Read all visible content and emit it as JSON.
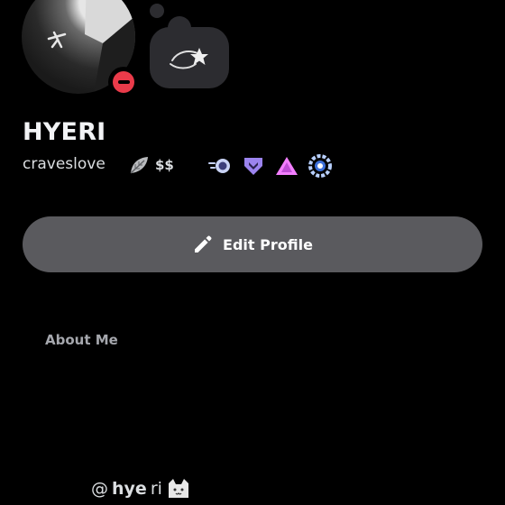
{
  "profile": {
    "display_name": "HYERI",
    "username": "craveslove",
    "dollars": "$$",
    "status": "dnd"
  },
  "actions": {
    "edit_profile_label": "Edit Profile"
  },
  "about": {
    "title": "About Me",
    "at_symbol": "@",
    "handle_bold": "hye",
    "handle_rest": "ri"
  },
  "icons": {
    "leaf": "leaf-icon",
    "badges": [
      "nitro-orb-badge",
      "hypesquad-bravery-badge",
      "triangle-badge",
      "laurel-badge"
    ],
    "status_bubble": "shooting-star-icon",
    "cat": "cat-icon"
  },
  "colors": {
    "background": "#000000",
    "button": "#5a5a5e",
    "dnd": "#ea3b4a",
    "bubble": "#2c2c30"
  }
}
